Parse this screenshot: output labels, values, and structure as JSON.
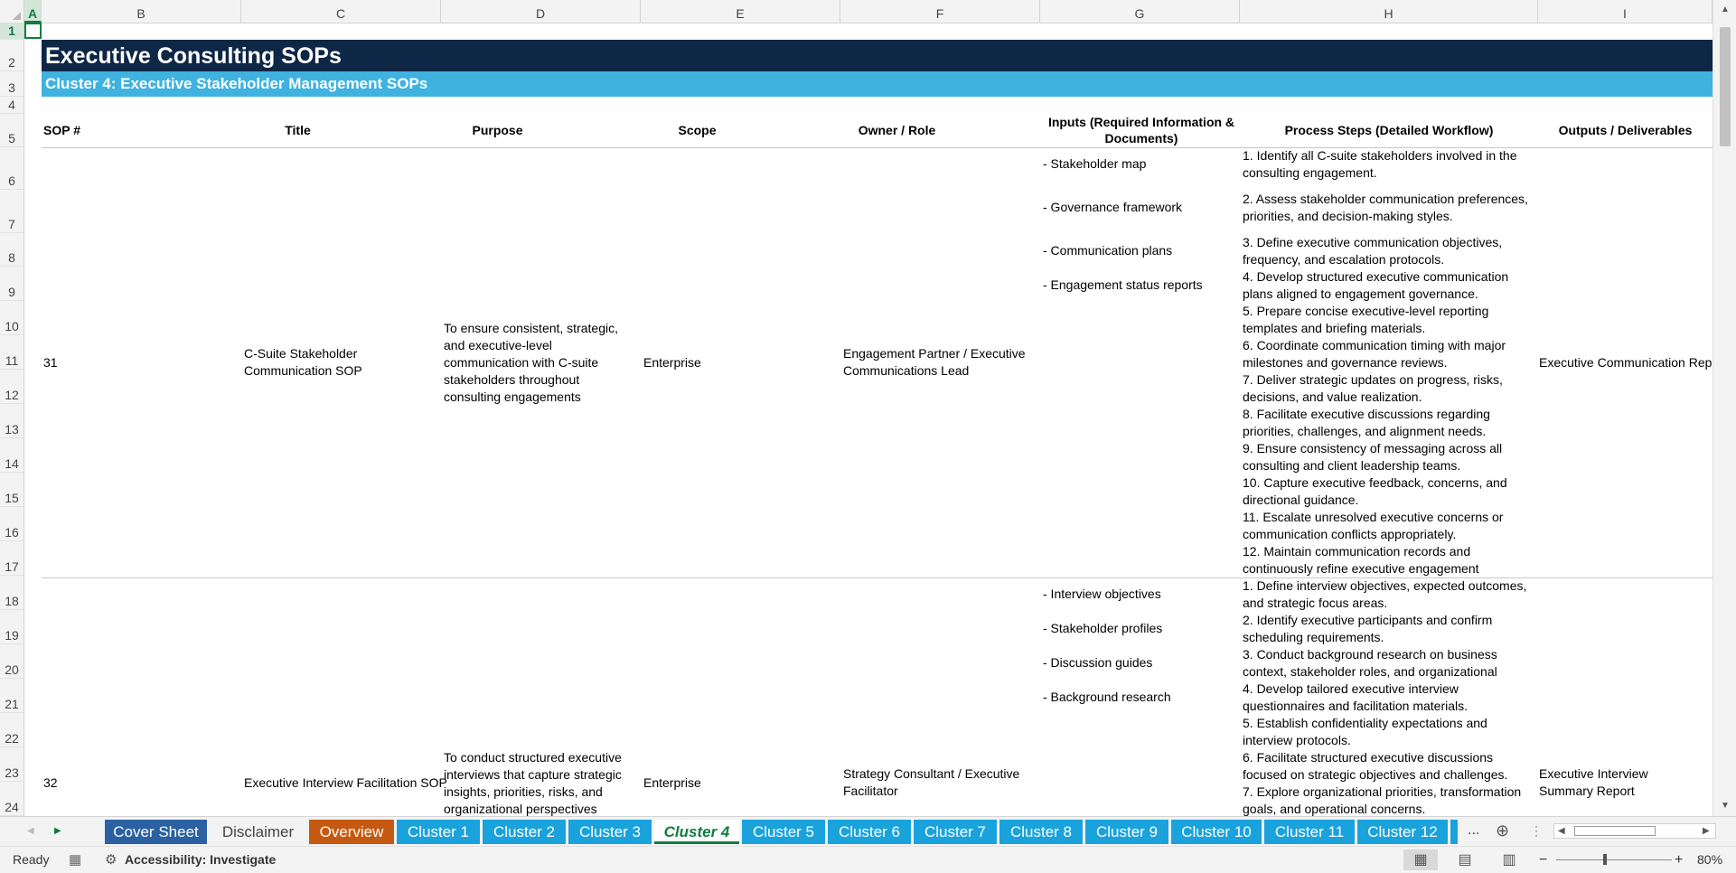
{
  "columns": [
    "A",
    "B",
    "C",
    "D",
    "E",
    "F",
    "G",
    "H",
    "I"
  ],
  "rows": [
    "1",
    "2",
    "3",
    "4",
    "5",
    "6",
    "7",
    "8",
    "9",
    "10",
    "11",
    "12",
    "13",
    "14",
    "15",
    "16",
    "17",
    "18",
    "19",
    "20",
    "21",
    "22",
    "23",
    "24"
  ],
  "title": "Executive Consulting SOPs",
  "subtitle": "Cluster 4: Executive Stakeholder Management SOPs",
  "headers": {
    "sop": "SOP #",
    "title": "Title",
    "purpose": "Purpose",
    "scope": "Scope",
    "owner": "Owner / Role",
    "inputs": "Inputs (Required Information & Documents)",
    "steps": "Process Steps (Detailed Workflow)",
    "outputs": "Outputs / Deliverables"
  },
  "records": [
    {
      "sop": "31",
      "title": "C-Suite Stakeholder Communication SOP",
      "purpose": "To ensure consistent, strategic, and executive-level communication with C-suite stakeholders throughout consulting engagements",
      "scope": "Enterprise",
      "owner": "Engagement Partner / Executive Communications Lead",
      "inputs": [
        "- Stakeholder map",
        "- Governance framework",
        "- Communication plans",
        "- Engagement status reports"
      ],
      "steps": [
        "1. Identify all C-suite stakeholders involved in the consulting engagement.",
        "2. Assess stakeholder communication preferences, priorities, and decision-making styles.",
        "3. Define executive communication objectives, frequency, and escalation protocols.",
        "4. Develop structured executive communication plans aligned to engagement governance.",
        "5. Prepare concise executive-level reporting templates and briefing materials.",
        "6. Coordinate communication timing with major milestones and governance reviews.",
        "7. Deliver strategic updates on progress, risks, decisions, and value realization.",
        "8. Facilitate executive discussions regarding priorities, challenges, and alignment needs.",
        "9. Ensure consistency of messaging across all consulting and client leadership teams.",
        "10. Capture executive feedback, concerns, and directional guidance.",
        "11. Escalate unresolved executive concerns or communication conflicts appropriately.",
        "12. Maintain communication records and continuously refine executive engagement"
      ],
      "outputs": "Executive Communication Repo"
    },
    {
      "sop": "32",
      "title": "Executive Interview Facilitation SOP",
      "purpose": "To conduct structured executive interviews that capture strategic insights, priorities, risks, and organizational perspectives",
      "scope": "Enterprise",
      "owner": "Strategy Consultant / Executive Facilitator",
      "inputs": [
        "- Interview objectives",
        "- Stakeholder profiles",
        "- Discussion guides",
        "- Background research"
      ],
      "steps": [
        "1. Define interview objectives, expected outcomes, and strategic focus areas.",
        "2. Identify executive participants and confirm scheduling requirements.",
        "3. Conduct background research on business context, stakeholder roles, and organizational",
        "4. Develop tailored executive interview questionnaires and facilitation materials.",
        "5. Establish confidentiality expectations and interview protocols.",
        "6. Facilitate structured executive discussions focused on strategic objectives and challenges.",
        "7. Explore organizational priorities, transformation goals, and operational concerns."
      ],
      "outputs": "Executive Interview Summary Report"
    }
  ],
  "tabs": [
    "Cover Sheet",
    "Disclaimer",
    "Overview",
    "Cluster 1",
    "Cluster 2",
    "Cluster 3",
    "Cluster 4",
    "Cluster 5",
    "Cluster 6",
    "Cluster 7",
    "Cluster 8",
    "Cluster 9",
    "Cluster 10",
    "Cluster 11",
    "Cluster 12"
  ],
  "tab_overflow": "...",
  "status": {
    "ready": "Ready",
    "accessibility": "Accessibility: Investigate",
    "zoom": "80%"
  },
  "colors": {
    "banner_dark": "#0f2746",
    "banner_light": "#3fb2e0",
    "tab_blue": "#1aa2dd",
    "tab_navy": "#2b61a2",
    "tab_orange": "#c65911",
    "excel_green": "#107c41"
  }
}
